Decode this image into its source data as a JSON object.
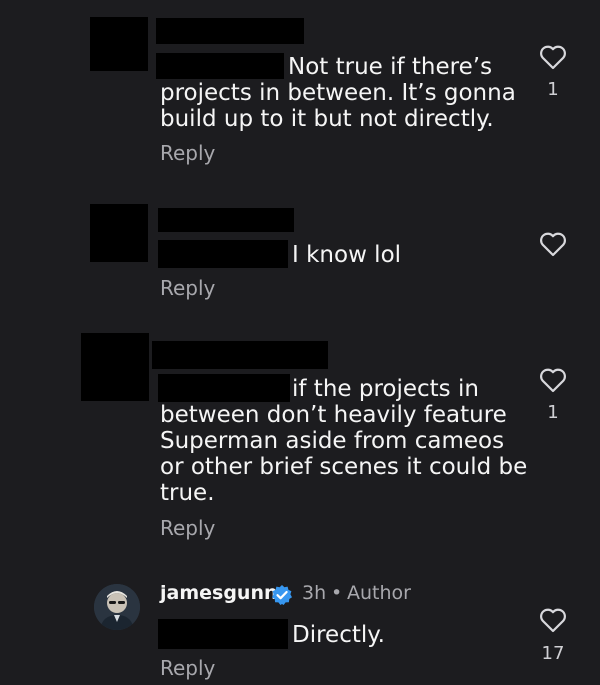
{
  "comments": [
    {
      "text_first_line": "Not true if there’s",
      "text_rest": "projects in between. It’s gonna\nbuild up to it but not directly.",
      "reply_label": "Reply",
      "like_count": "1"
    },
    {
      "text_first_line": "I know lol",
      "text_rest": "",
      "reply_label": "Reply",
      "like_count": ""
    },
    {
      "text_first_line": "if the projects in",
      "text_rest": "between don’t heavily feature\nSuperman aside from cameos\nor other brief scenes it could be\ntrue.",
      "reply_label": "Reply",
      "like_count": "1"
    },
    {
      "username": "jamesgunn",
      "time": "3h",
      "separator": "•",
      "author_label": "Author",
      "text_first_line": "Directly.",
      "text_rest": "",
      "reply_label": "Reply",
      "like_count": "17"
    }
  ],
  "colors": {
    "background": "#1c1c1f",
    "text": "#f5f5f5",
    "secondary_text": "#a8a8ad",
    "verified_badge": "#3797f0",
    "redaction": "#000000"
  }
}
